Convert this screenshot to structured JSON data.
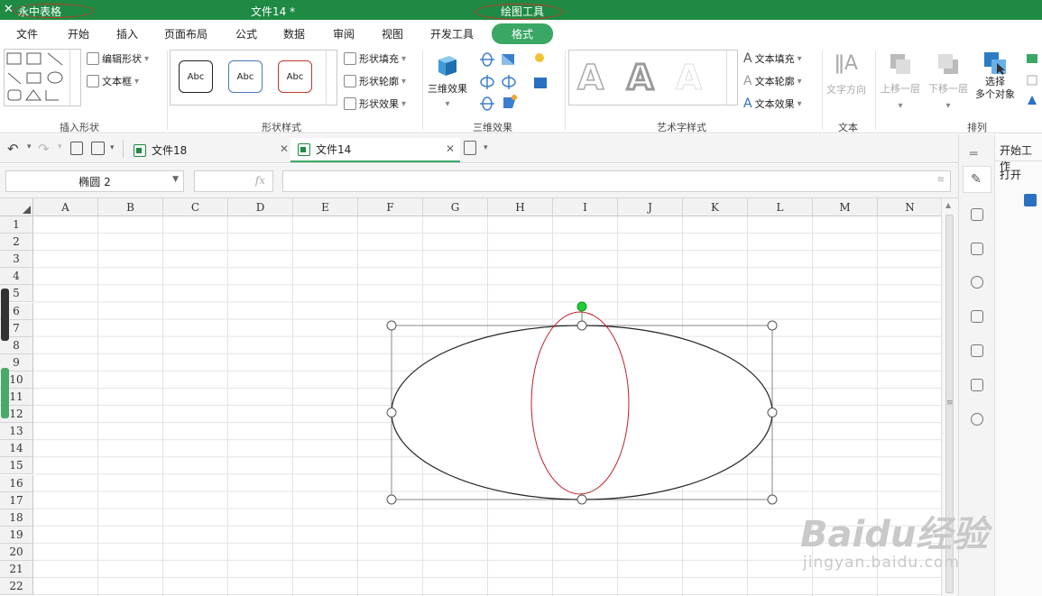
{
  "titlebar": {
    "app_name": "永中表格",
    "document_title": "文件14 *",
    "context_tool": "绘图工具",
    "accent_color": "#1e8a43"
  },
  "menu": {
    "tabs": [
      "文件",
      "开始",
      "插入",
      "页面布局",
      "公式",
      "数据",
      "审阅",
      "视图",
      "开发工具",
      "格式"
    ],
    "active": "格式"
  },
  "ribbon": {
    "insert_shapes": {
      "label": "插入形状",
      "edit_shape": "编辑形状",
      "text_box": "文本框"
    },
    "shape_styles": {
      "label": "形状样式",
      "gallery": [
        "Abc",
        "Abc",
        "Abc"
      ],
      "fill": "形状填充",
      "outline": "形状轮廓",
      "effects": "形状效果"
    },
    "three_d": {
      "label": "三维效果",
      "button": "三维效果"
    },
    "wordart": {
      "label": "艺术字样式",
      "samples": [
        "A",
        "A",
        "A"
      ],
      "text_fill": "文本填充",
      "text_outline": "文本轮廓",
      "text_effects": "文本效果"
    },
    "text": {
      "label": "文本",
      "direction": "文字方向"
    },
    "arrange": {
      "label": "排列",
      "bring_forward": "上移一层",
      "send_backward": "下移一层",
      "select_multi_line1": "选择",
      "select_multi_line2": "多个对象"
    }
  },
  "doc_tabs": [
    {
      "label": "文件18",
      "active": false
    },
    {
      "label": "文件14",
      "active": true
    }
  ],
  "formula_bar": {
    "name_box": "椭圆 2",
    "fx": "fx",
    "formula": ""
  },
  "grid": {
    "columns": [
      "A",
      "B",
      "C",
      "D",
      "E",
      "F",
      "G",
      "H",
      "I",
      "J",
      "K",
      "L",
      "M",
      "N"
    ],
    "rows": [
      "1",
      "2",
      "3",
      "4",
      "5",
      "6",
      "7",
      "8",
      "9",
      "10",
      "11",
      "12",
      "13",
      "14",
      "15",
      "16",
      "17",
      "18",
      "19",
      "20",
      "21",
      "22"
    ]
  },
  "shapes": {
    "selected_ellipse": {
      "name": "椭圆 2",
      "stroke": "#222222"
    },
    "inner_ellipse": {
      "stroke": "#c0202a"
    },
    "rotation_handle_color": "#22cc33"
  },
  "side_panel": {
    "start_work": "开始工作",
    "open": "打开"
  },
  "watermark": {
    "brand": "Baidu经验",
    "url": "jingyan.baidu.com"
  },
  "icons": {
    "undo": "undo-icon",
    "redo": "redo-icon",
    "print_preview": "print-preview-icon",
    "save": "save-icon",
    "new_doc": "new-document-icon",
    "pencil": "pencil-icon",
    "sliders": "sliders-icon",
    "cube": "cube-icon",
    "clock": "clock-icon",
    "clipboard": "clipboard-icon",
    "copy": "copy-icon",
    "edit": "edit-icon",
    "help": "help-icon"
  }
}
